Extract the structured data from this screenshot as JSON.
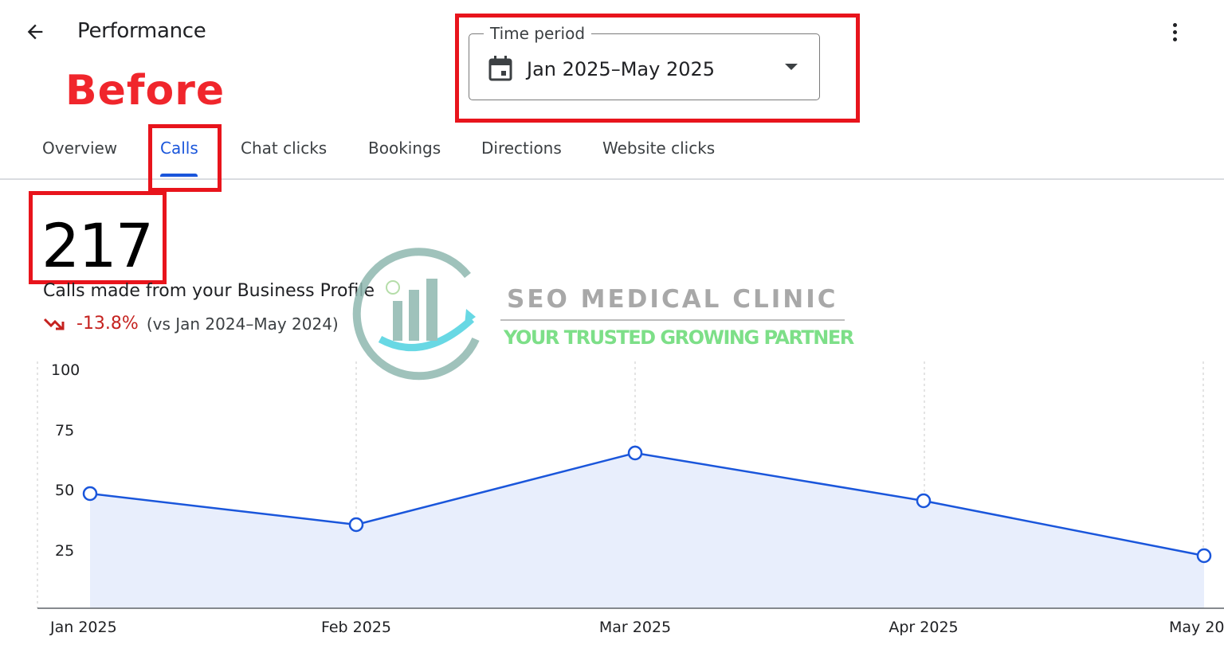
{
  "header": {
    "title": "Performance",
    "back_icon": "arrow-back-icon",
    "more_icon": "more-vert-icon"
  },
  "annotation": {
    "label": "Before",
    "color": "#f0262c",
    "highlight_color": "#e8141c"
  },
  "time_period": {
    "label": "Time period",
    "value": "Jan 2025–May 2025",
    "icon": "calendar-icon",
    "dropdown_icon": "dropdown-arrow-icon"
  },
  "tabs": [
    {
      "label": "Overview",
      "active": false
    },
    {
      "label": "Calls",
      "active": true
    },
    {
      "label": "Chat clicks",
      "active": false
    },
    {
      "label": "Bookings",
      "active": false
    },
    {
      "label": "Directions",
      "active": false
    },
    {
      "label": "Website clicks",
      "active": false
    }
  ],
  "metric": {
    "value": "217",
    "description": "Calls made from your Business Profile",
    "change": "-13.8%",
    "comparison": "(vs Jan 2024–May 2024)",
    "trend_icon": "trending-down-icon",
    "change_color": "#c5221f"
  },
  "watermark": {
    "name": "SEO MEDICAL CLINIC",
    "tagline": "YOUR TRUSTED GROWING PARTNER"
  },
  "chart_data": {
    "type": "area",
    "x": [
      "Jan 2025",
      "Feb 2025",
      "Mar 2025",
      "Apr 2025",
      "May 20"
    ],
    "series": [
      {
        "values": [
          48,
          35,
          65,
          45,
          22
        ]
      }
    ],
    "yticks": [
      "100",
      "75",
      "50",
      "25"
    ],
    "ylim": [
      0,
      100
    ],
    "grid": "vertical dashed",
    "line_color": "#1a56db",
    "fill_color": "#e8eefc"
  }
}
